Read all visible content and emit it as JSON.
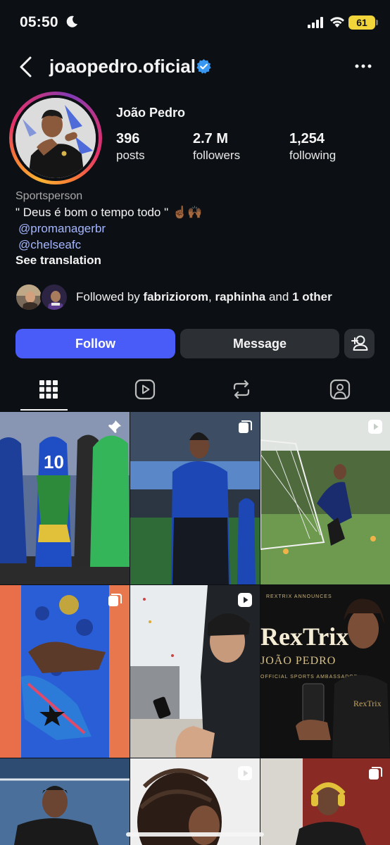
{
  "status_bar": {
    "time": "05:50",
    "battery": "61"
  },
  "header": {
    "username": "joaopedro.oficial",
    "verified": true
  },
  "profile": {
    "display_name": "João Pedro",
    "stats": [
      {
        "value": "396",
        "label": "posts"
      },
      {
        "value": "2.7 M",
        "label": "followers"
      },
      {
        "value": "1,254",
        "label": "following"
      }
    ],
    "category": "Sportsperson",
    "bio": "\" Deus é bom o tempo todo \"",
    "bio_emoji": "☝🏾🙌🏾",
    "mentions": [
      "@promanagerbr",
      "@chelseafc"
    ],
    "see_translation": "See translation"
  },
  "followed_by": {
    "prefix": "Followed by ",
    "user1": "fabriziorom",
    "sep1": ", ",
    "user2": "raphinha",
    "sep2": " and ",
    "rest": "1 other"
  },
  "actions": {
    "follow": "Follow",
    "message": "Message"
  },
  "tabs": [
    "grid-icon",
    "reels-icon",
    "reposts-icon",
    "tagged-icon"
  ],
  "posts": [
    {
      "type": "pinned"
    },
    {
      "type": "carousel"
    },
    {
      "type": "reel"
    },
    {
      "type": "carousel"
    },
    {
      "type": "reel"
    },
    {
      "type": "none"
    },
    {
      "type": "none"
    },
    {
      "type": "reel"
    },
    {
      "type": "carousel"
    }
  ],
  "overlay_text": {
    "rextrix_top": "REXTRIX ANNOUNCES",
    "rextrix_brand": "RexTrix",
    "rextrix_name": "JOÃO PEDRO",
    "rextrix_role": "OFFICIAL SPORTS AMBASSADOR",
    "rextrix_shirt": "RexTrix"
  }
}
